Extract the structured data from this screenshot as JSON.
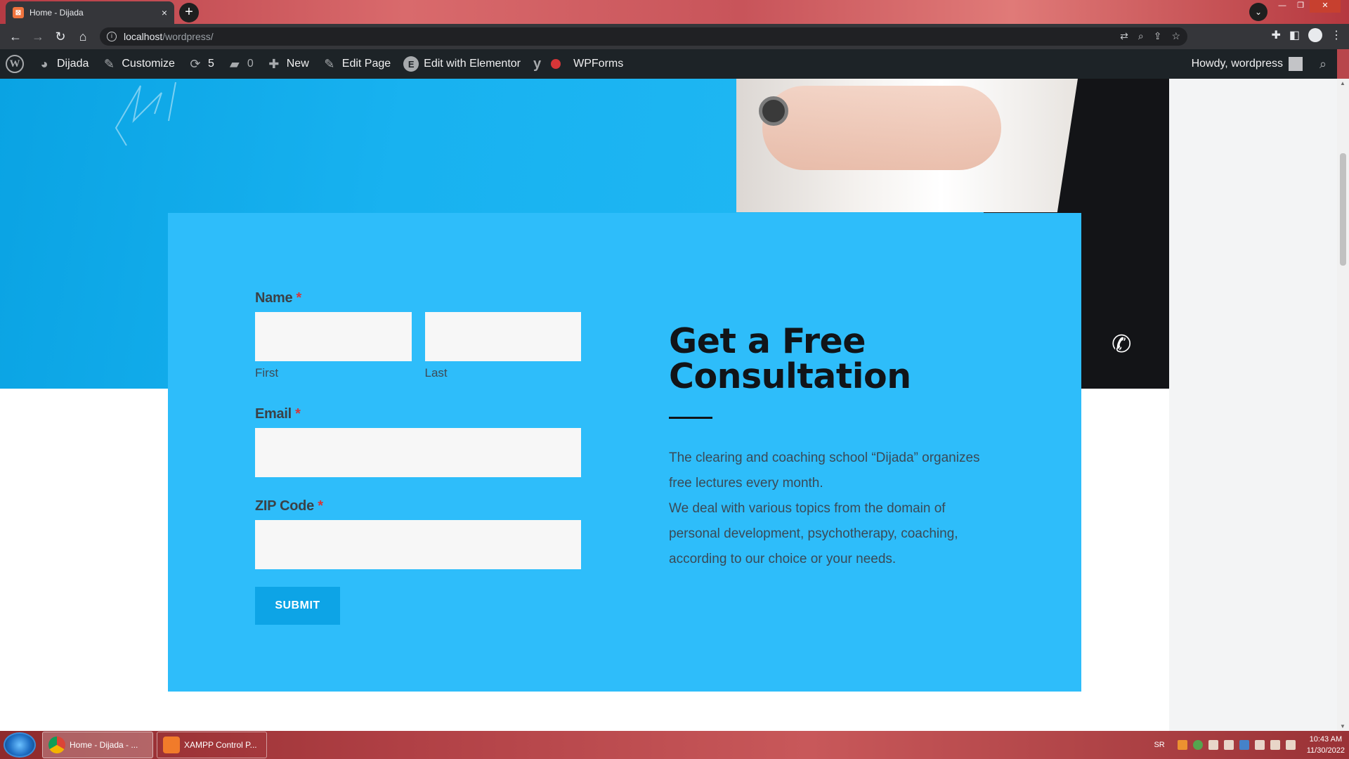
{
  "browser": {
    "tab_title": "Home - Dijada",
    "tab_close": "×",
    "new_tab": "+",
    "url_host": "localhost",
    "url_path": "/wordpress/"
  },
  "admin_bar": {
    "site_name": "Dijada",
    "customize": "Customize",
    "updates_count": "5",
    "comments_count": "0",
    "new": "New",
    "edit_page": "Edit Page",
    "edit_elementor": "Edit with Elementor",
    "wpforms": "WPForms",
    "howdy": "Howdy, wordpress"
  },
  "form": {
    "name_label": "Name",
    "first_sublabel": "First",
    "last_sublabel": "Last",
    "email_label": "Email",
    "zip_label": "ZIP Code",
    "required_marker": "*",
    "submit": "SUBMIT"
  },
  "consultation": {
    "heading_line1": "Get a Free",
    "heading_line2": "Consultation",
    "paragraph1": "The clearing and coaching school “Dijada” organizes free lectures every month.",
    "paragraph2": "We deal with various topics from the domain of personal development, psychotherapy, coaching, according to our choice or your needs."
  },
  "taskbar": {
    "task1": "Home - Dijada - ...",
    "task2": "XAMPP Control P...",
    "lang": "SR",
    "time": "10:43 AM",
    "date": "11/30/2022"
  },
  "colors": {
    "card_bg": "#2ebdfa",
    "submit_bg": "#0da4e6",
    "required": "#d63638",
    "admin_bar": "#1d2327"
  },
  "icons": [
    "wordpress-icon",
    "dashboard-icon",
    "brush-icon",
    "refresh-icon",
    "comment-icon",
    "plus-icon",
    "pencil-icon",
    "elementor-icon",
    "yoast-icon",
    "phone-icon",
    "search-icon"
  ]
}
